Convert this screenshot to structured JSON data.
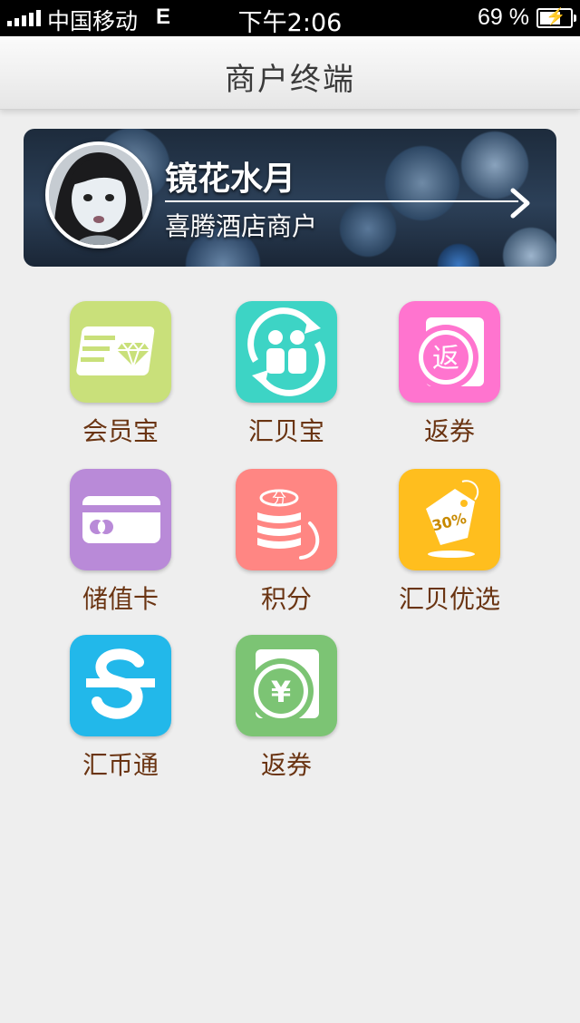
{
  "status_bar": {
    "carrier": "中国移动",
    "network": "E",
    "time": "下午2:06",
    "battery": "69 %"
  },
  "navbar": {
    "title": "商户终端"
  },
  "profile": {
    "name": "镜花水月",
    "subtitle": "喜腾酒店商户"
  },
  "menu": [
    {
      "label": "会员宝",
      "icon": "diamond-card-icon",
      "color": "#c9e07a"
    },
    {
      "label": "汇贝宝",
      "icon": "people-cycle-icon",
      "color": "#3dd4c5"
    },
    {
      "label": "返券",
      "icon": "return-coupon-icon",
      "color": "#ff74cf",
      "icon_text": "返"
    },
    {
      "label": "储值卡",
      "icon": "stored-card-icon",
      "color": "#b98ad8"
    },
    {
      "label": "积分",
      "icon": "coin-stack-icon",
      "color": "#ff8683",
      "icon_text": "分"
    },
    {
      "label": "汇贝优选",
      "icon": "price-tag-icon",
      "color": "#ffbe1e",
      "icon_text": "30%"
    },
    {
      "label": "汇币通",
      "icon": "currency-s-icon",
      "color": "#22b8ea"
    },
    {
      "label": "返券",
      "icon": "yen-coupon-icon",
      "color": "#7cc474",
      "icon_text": "¥"
    }
  ]
}
